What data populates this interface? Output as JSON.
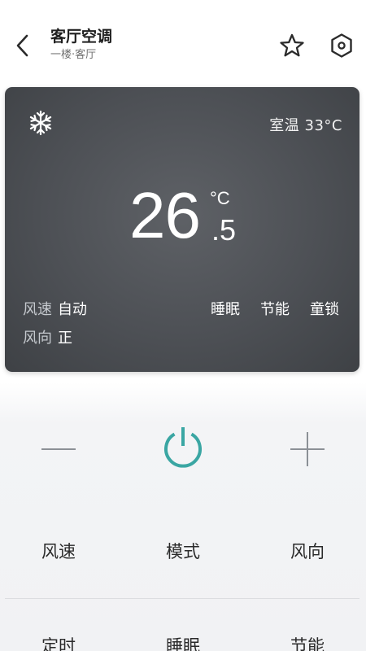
{
  "header": {
    "title": "客厅空调",
    "subtitle": "一楼·客厅",
    "icons": {
      "back": "chevron-left-icon",
      "favorite": "star-icon",
      "settings": "hexagon-settings-icon"
    }
  },
  "status": {
    "mode_icon": "snowflake-icon",
    "room_temp": "室温 33°C",
    "set_temp_whole": "26",
    "set_temp_decimal": ".5",
    "temp_unit": "°C",
    "fan_speed_label": "风速",
    "fan_speed_value": "自动",
    "fan_dir_label": "风向",
    "fan_dir_value": "正",
    "flags": [
      "睡眠",
      "节能",
      "童锁"
    ]
  },
  "controls": {
    "decrease_icon": "minus-icon",
    "power_icon": "power-icon",
    "increase_icon": "plus-icon",
    "power_color": "#3aa6a3"
  },
  "function_grid": {
    "row1": [
      "风速",
      "模式",
      "风向"
    ],
    "row2": [
      "定时",
      "睡眠",
      "节能"
    ]
  }
}
